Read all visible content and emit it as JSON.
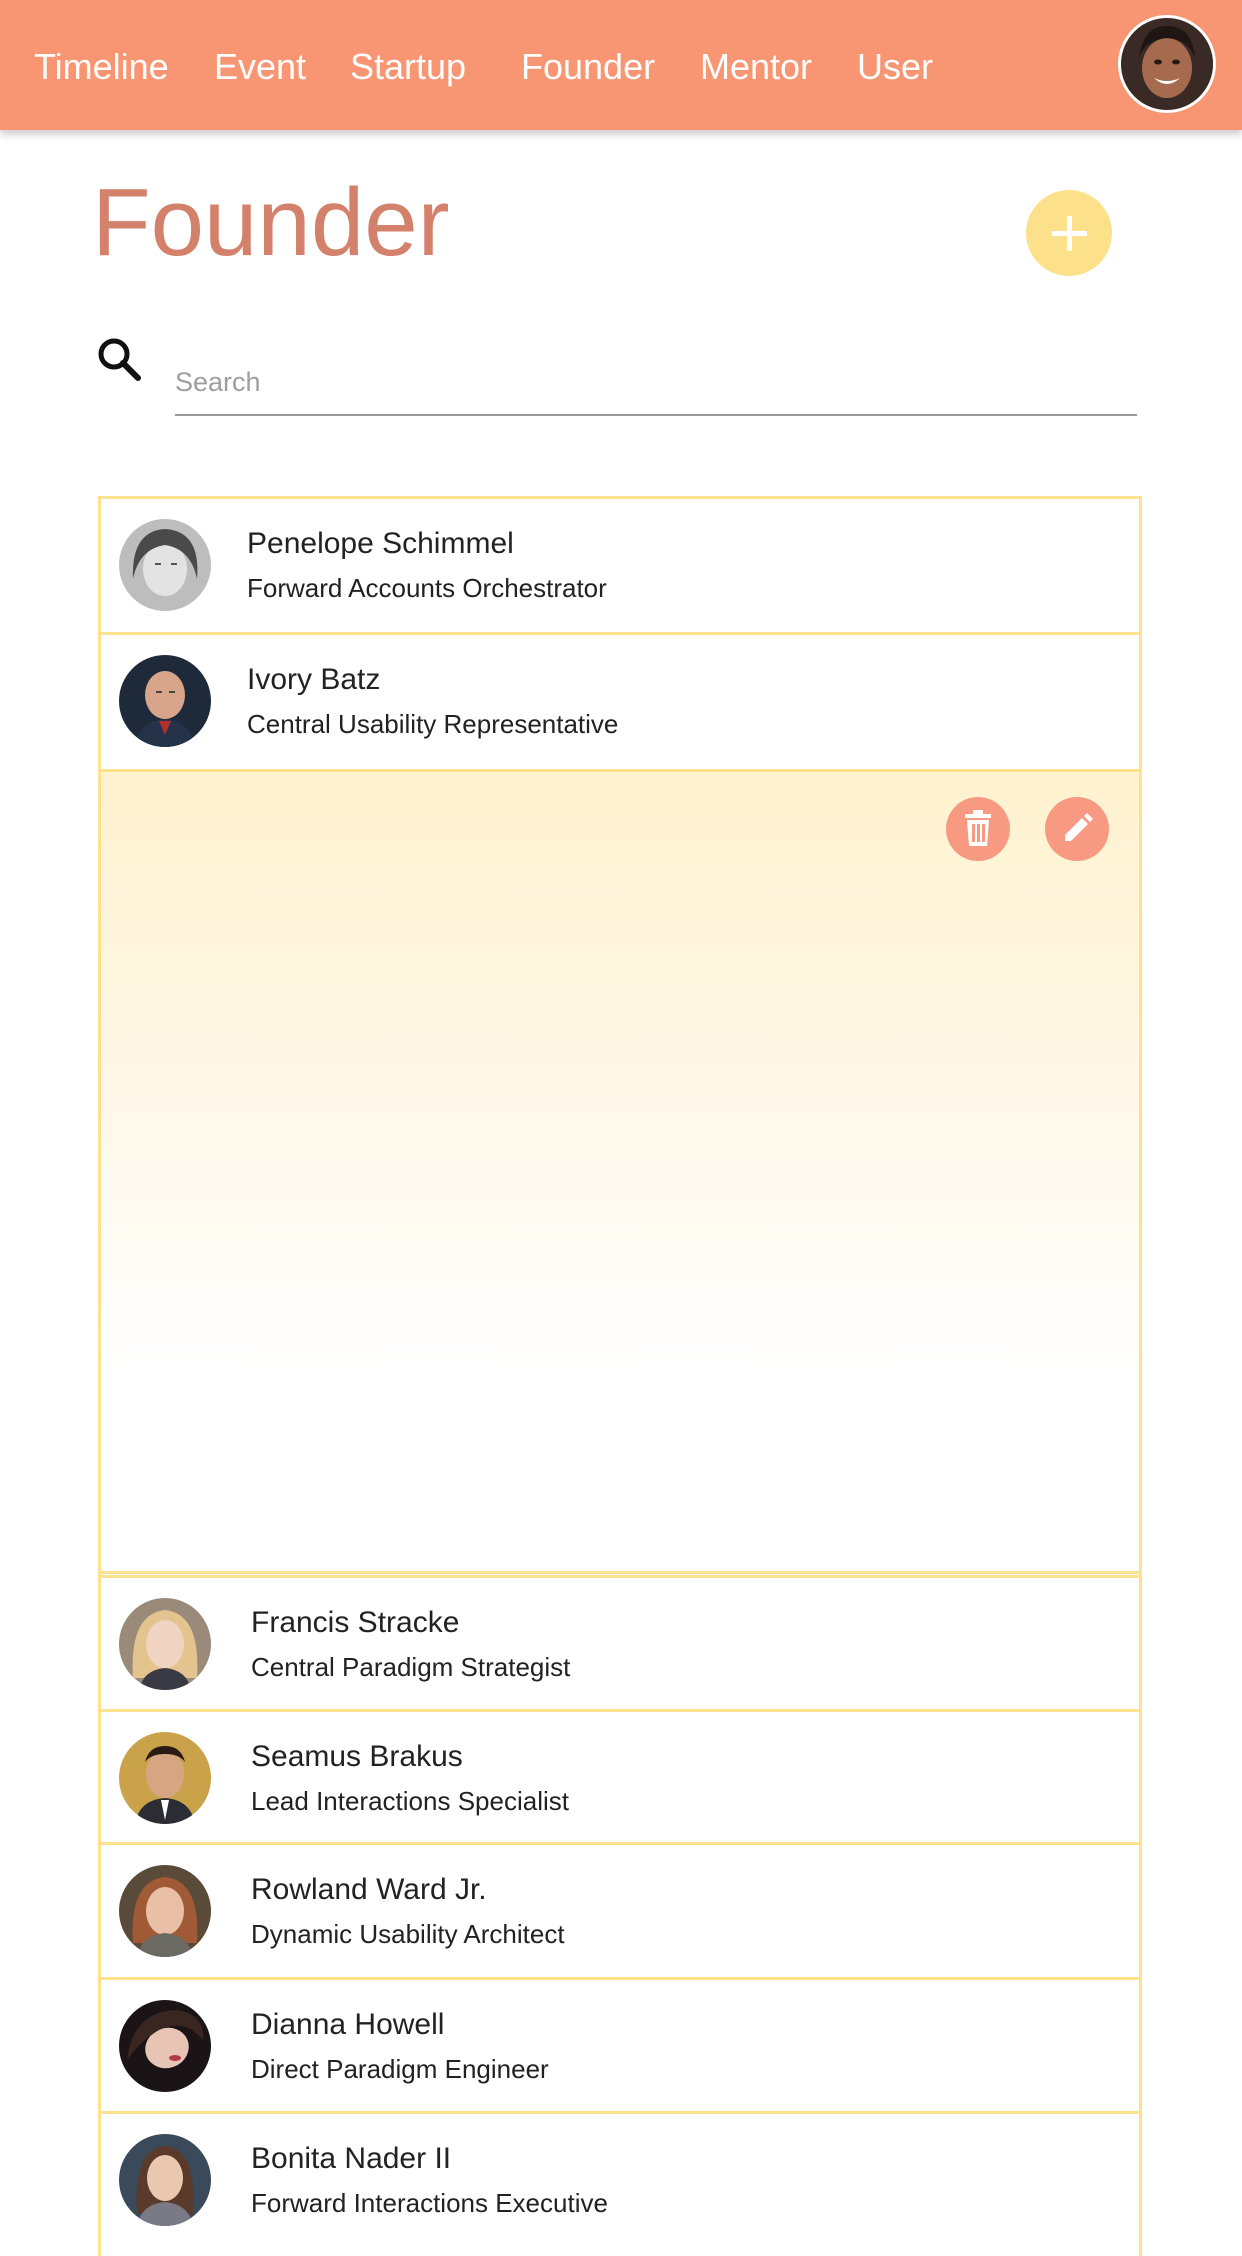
{
  "nav": {
    "items": [
      {
        "label": "Timeline"
      },
      {
        "label": "Event"
      },
      {
        "label": "Startup"
      },
      {
        "label": "Founder"
      },
      {
        "label": "Mentor"
      },
      {
        "label": "User"
      }
    ],
    "avatar_icon": "user-avatar"
  },
  "page": {
    "title": "Founder",
    "add_icon": "plus-icon"
  },
  "search": {
    "placeholder": "Search",
    "value": "",
    "icon": "search-icon"
  },
  "founders": [
    {
      "name": "Penelope Schimmel",
      "title": "Forward Accounts Orchestrator"
    },
    {
      "name": "Ivory Batz",
      "title": "Central Usability Representative"
    },
    {
      "name": "Francis Stracke",
      "title": "Central Paradigm Strategist"
    },
    {
      "name": "Seamus Brakus",
      "title": "Lead Interactions Specialist"
    },
    {
      "name": "Rowland Ward Jr.",
      "title": "Dynamic Usability Architect"
    },
    {
      "name": "Dianna Howell",
      "title": "Direct Paradigm Engineer"
    },
    {
      "name": "Bonita Nader II",
      "title": "Forward Interactions Executive"
    }
  ],
  "expanded_row": {
    "actions": [
      "trash-icon",
      "pencil-icon"
    ]
  },
  "colors": {
    "navbar": "#f89673",
    "title": "#d4816c",
    "accent_yellow": "#fde08a",
    "border": "#fce18e",
    "action_button": "#f89a82"
  }
}
